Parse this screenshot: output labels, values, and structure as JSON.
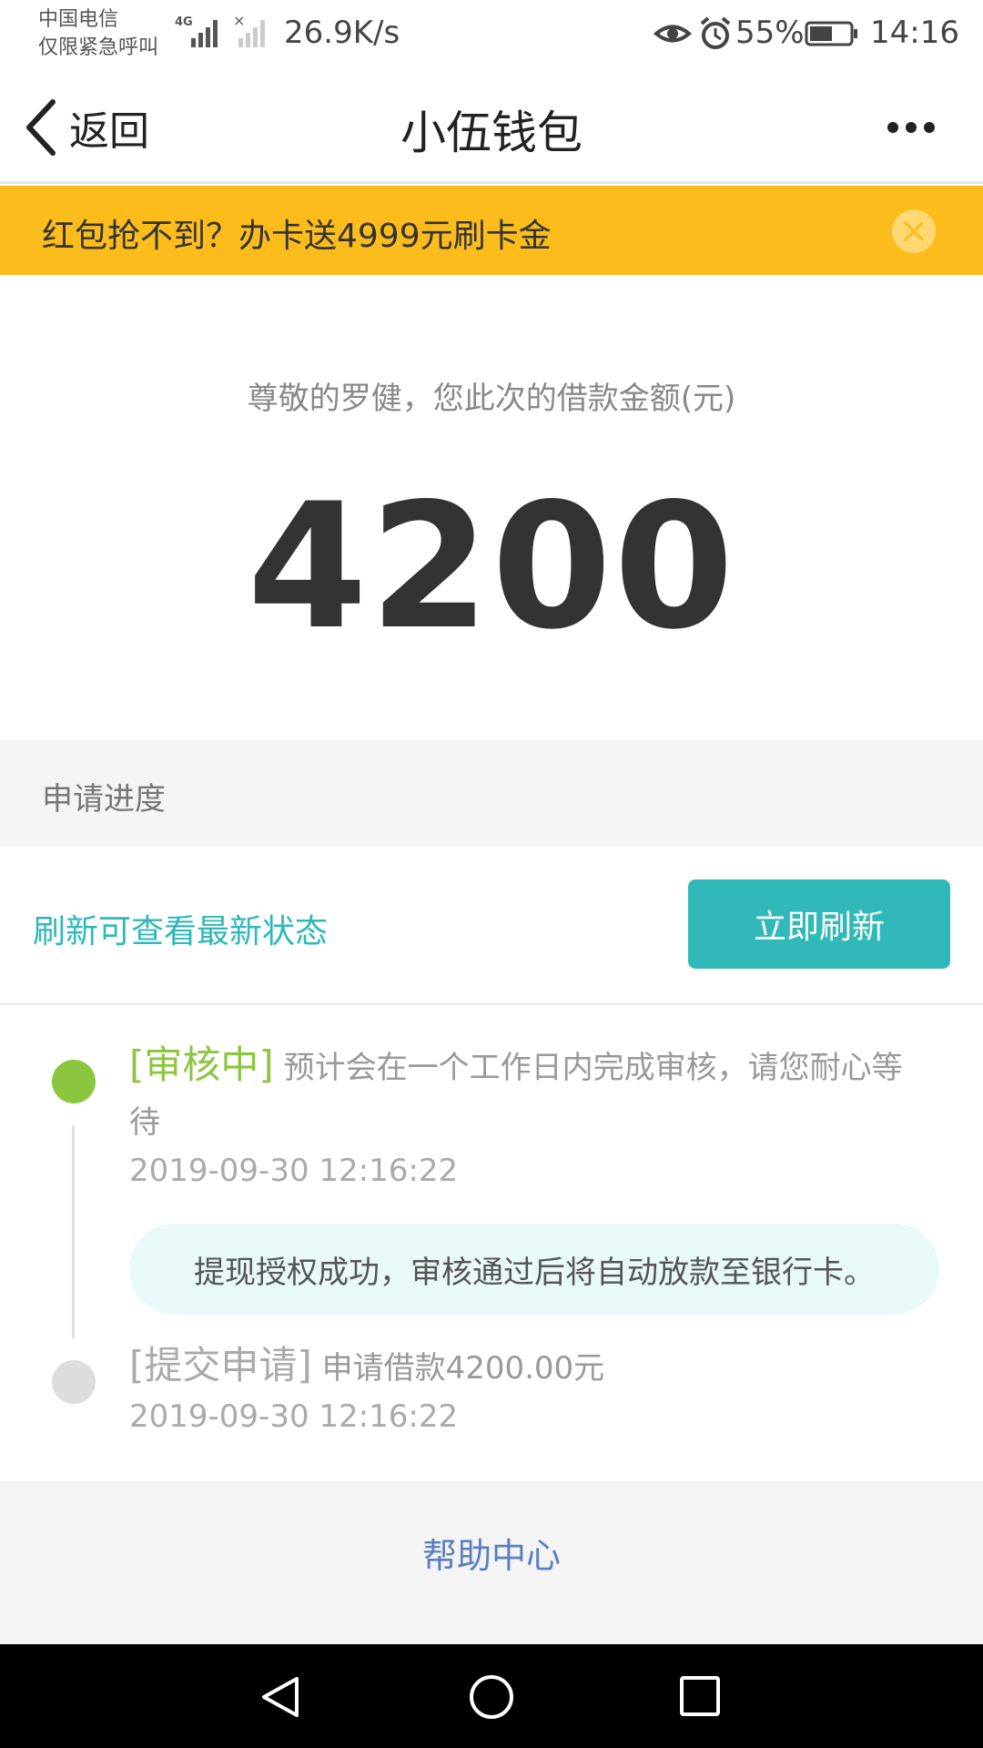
{
  "status_bar": {
    "carrier_line1": "中国电信",
    "carrier_line2": "仅限紧急呼叫",
    "network_type": "4G",
    "net_speed": "26.9K/s",
    "battery": "55%",
    "time": "14:16"
  },
  "nav": {
    "back_label": "返回",
    "title": "小伍钱包"
  },
  "banner": {
    "text": "红包抢不到？办卡送4999元刷卡金",
    "color": "#fbbc1c"
  },
  "loan": {
    "caption": "尊敬的罗健，您此次的借款金额(元)",
    "amount": "4200"
  },
  "progress": {
    "section_title": "申请进度",
    "refresh_hint": "刷新可查看最新状态",
    "refresh_button": "立即刷新",
    "accent_color": "#31b9b9",
    "timeline": [
      {
        "status": "[审核中]",
        "text": " 预计会在一个工作日内完成审核，请您耐心等待",
        "time": "2019-09-30 12:16:22",
        "notice": "提现授权成功，审核通过后将自动放款至银行卡。",
        "active": true,
        "color": "#8cc63f"
      },
      {
        "status": "[提交申请]",
        "text": " 申请借款4200.00元",
        "time": "2019-09-30 12:16:22",
        "active": false,
        "color": "#dddddd"
      }
    ]
  },
  "footer": {
    "help_link": "帮助中心"
  },
  "icons": {
    "back": "chevron-left-icon",
    "more": "more-dots-icon",
    "close": "close-icon",
    "eye": "eye-icon",
    "alarm": "alarm-icon",
    "battery": "battery-icon"
  }
}
